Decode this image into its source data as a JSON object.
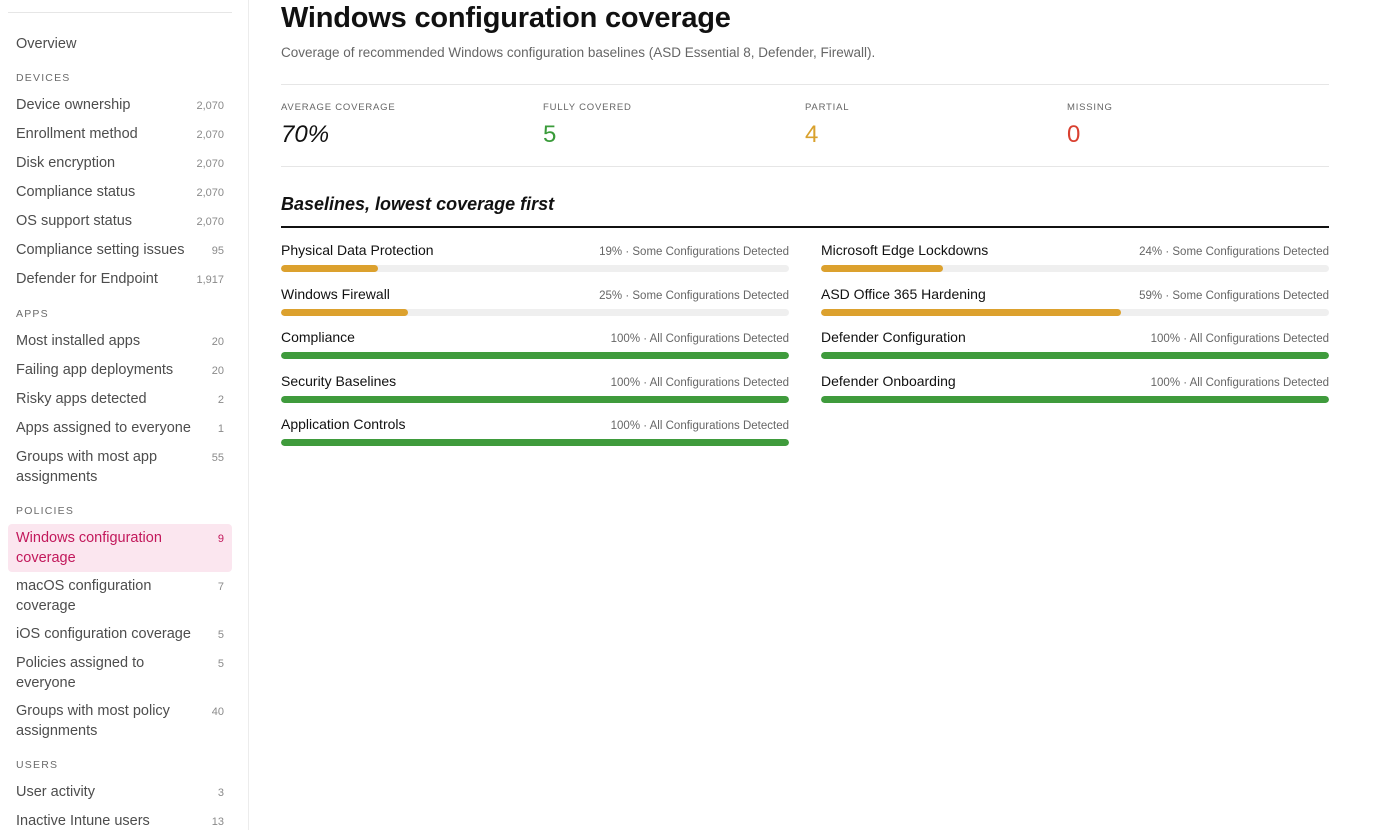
{
  "sidebar": {
    "overview": "Overview",
    "sections": [
      {
        "heading": "DEVICES",
        "items": [
          {
            "label": "Device ownership",
            "count": "2,070"
          },
          {
            "label": "Enrollment method",
            "count": "2,070"
          },
          {
            "label": "Disk encryption",
            "count": "2,070"
          },
          {
            "label": "Compliance status",
            "count": "2,070"
          },
          {
            "label": "OS support status",
            "count": "2,070"
          },
          {
            "label": "Compliance setting issues",
            "count": "95"
          },
          {
            "label": "Defender for Endpoint",
            "count": "1,917"
          }
        ]
      },
      {
        "heading": "APPS",
        "items": [
          {
            "label": "Most installed apps",
            "count": "20"
          },
          {
            "label": "Failing app deployments",
            "count": "20"
          },
          {
            "label": "Risky apps detected",
            "count": "2"
          },
          {
            "label": "Apps assigned to everyone",
            "count": "1"
          },
          {
            "label": "Groups with most app assignments",
            "count": "55"
          }
        ]
      },
      {
        "heading": "POLICIES",
        "items": [
          {
            "label": "Windows configuration coverage",
            "count": "9",
            "active": true
          },
          {
            "label": "macOS configuration coverage",
            "count": "7"
          },
          {
            "label": "iOS configuration coverage",
            "count": "5"
          },
          {
            "label": "Policies assigned to everyone",
            "count": "5"
          },
          {
            "label": "Groups with most policy assignments",
            "count": "40"
          }
        ]
      },
      {
        "heading": "USERS",
        "items": [
          {
            "label": "User activity",
            "count": "3"
          },
          {
            "label": "Inactive Intune users",
            "count": "13"
          }
        ]
      }
    ]
  },
  "main": {
    "title": "Windows configuration coverage",
    "subtitle": "Coverage of recommended Windows configuration baselines (ASD Essential 8, Defender, Firewall).",
    "stats": [
      {
        "label": "AVERAGE COVERAGE",
        "value": "70%",
        "kind": "avg"
      },
      {
        "label": "FULLY COVERED",
        "value": "5",
        "kind": "full"
      },
      {
        "label": "PARTIAL",
        "value": "4",
        "kind": "partial"
      },
      {
        "label": "MISSING",
        "value": "0",
        "kind": "missing"
      }
    ],
    "section_title": "Baselines, lowest coverage first",
    "colors": {
      "partial": "#dca12e",
      "full": "#3f9b3c",
      "track": "#efefef"
    },
    "baselines": [
      {
        "name": "Physical Data Protection",
        "meta": "19% · Some Configurations Detected",
        "percent": 19,
        "status": "partial"
      },
      {
        "name": "Microsoft Edge Lockdowns",
        "meta": "24% · Some Configurations Detected",
        "percent": 24,
        "status": "partial"
      },
      {
        "name": "Windows Firewall",
        "meta": "25% · Some Configurations Detected",
        "percent": 25,
        "status": "partial"
      },
      {
        "name": "ASD Office 365 Hardening",
        "meta": "59% · Some Configurations Detected",
        "percent": 59,
        "status": "partial"
      },
      {
        "name": "Compliance",
        "meta": "100% · All Configurations Detected",
        "percent": 100,
        "status": "full"
      },
      {
        "name": "Defender Configuration",
        "meta": "100% · All Configurations Detected",
        "percent": 100,
        "status": "full"
      },
      {
        "name": "Security Baselines",
        "meta": "100% · All Configurations Detected",
        "percent": 100,
        "status": "full"
      },
      {
        "name": "Defender Onboarding",
        "meta": "100% · All Configurations Detected",
        "percent": 100,
        "status": "full"
      },
      {
        "name": "Application Controls",
        "meta": "100% · All Configurations Detected",
        "percent": 100,
        "status": "full"
      }
    ]
  }
}
